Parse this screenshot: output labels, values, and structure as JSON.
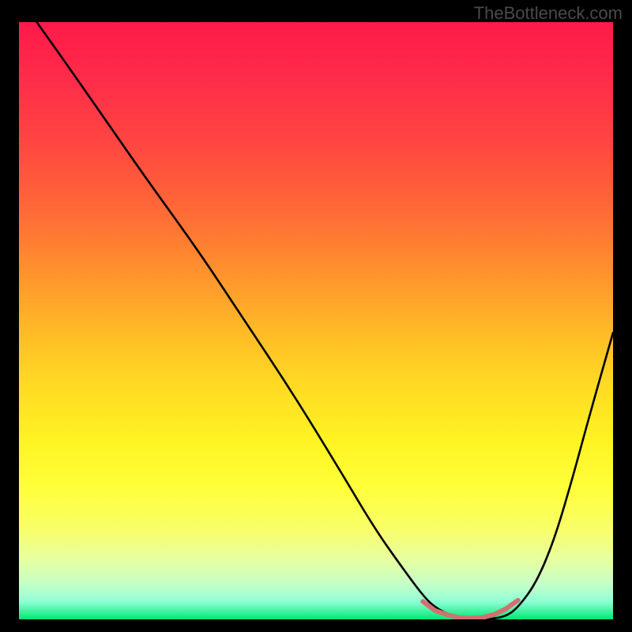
{
  "watermark": "TheBottleneck.com",
  "chart_data": {
    "type": "line",
    "title": "",
    "xlabel": "",
    "ylabel": "",
    "xlim": [
      0,
      100
    ],
    "ylim": [
      0,
      100
    ],
    "gradient_stops": [
      {
        "offset": 0.0,
        "color": "#ff1a4a"
      },
      {
        "offset": 0.1,
        "color": "#ff2d49"
      },
      {
        "offset": 0.2,
        "color": "#ff4542"
      },
      {
        "offset": 0.3,
        "color": "#ff6438"
      },
      {
        "offset": 0.4,
        "color": "#ff8a2f"
      },
      {
        "offset": 0.5,
        "color": "#ffb328"
      },
      {
        "offset": 0.6,
        "color": "#ffd823"
      },
      {
        "offset": 0.7,
        "color": "#fff323"
      },
      {
        "offset": 0.78,
        "color": "#ffff3a"
      },
      {
        "offset": 0.85,
        "color": "#f8ff6a"
      },
      {
        "offset": 0.9,
        "color": "#e6ffa0"
      },
      {
        "offset": 0.94,
        "color": "#c7ffc7"
      },
      {
        "offset": 0.97,
        "color": "#90ffd5"
      },
      {
        "offset": 1.0,
        "color": "#00e874"
      }
    ],
    "curve": {
      "x": [
        3,
        8,
        15,
        22,
        30,
        38,
        46,
        54,
        60,
        65,
        68,
        70,
        73,
        76,
        79,
        82,
        84,
        87,
        90,
        93,
        96,
        100
      ],
      "y": [
        100,
        93,
        83,
        73,
        62,
        50,
        38,
        25,
        15,
        8,
        4,
        2,
        0.5,
        0,
        0,
        0.5,
        2,
        6,
        13,
        23,
        34,
        48
      ]
    },
    "flat_marker": {
      "x": [
        68,
        70,
        72,
        74,
        76,
        78,
        80,
        82,
        84
      ],
      "y": [
        3,
        1.5,
        0.8,
        0.3,
        0.2,
        0.3,
        0.8,
        1.8,
        3.2
      ],
      "color": "#d27070",
      "linewidth": 6
    }
  }
}
